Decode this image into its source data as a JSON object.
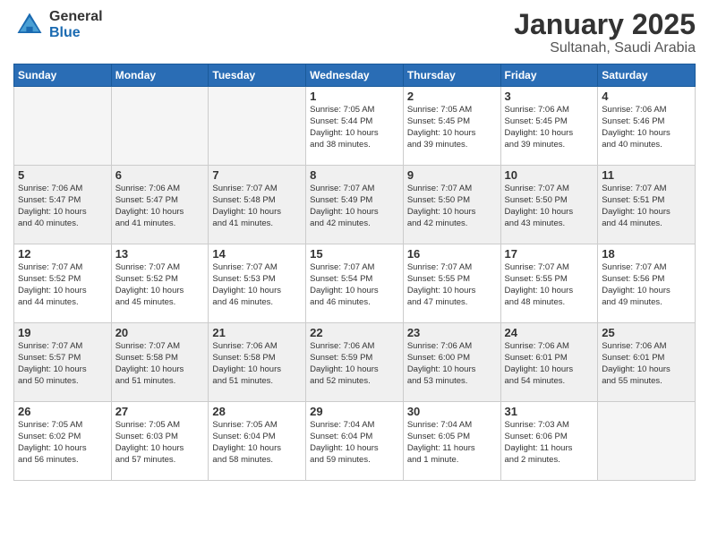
{
  "header": {
    "logo_general": "General",
    "logo_blue": "Blue",
    "month": "January 2025",
    "location": "Sultanah, Saudi Arabia"
  },
  "weekdays": [
    "Sunday",
    "Monday",
    "Tuesday",
    "Wednesday",
    "Thursday",
    "Friday",
    "Saturday"
  ],
  "weeks": [
    [
      {
        "day": "",
        "info": "",
        "empty": true
      },
      {
        "day": "",
        "info": "",
        "empty": true
      },
      {
        "day": "",
        "info": "",
        "empty": true
      },
      {
        "day": "1",
        "info": "Sunrise: 7:05 AM\nSunset: 5:44 PM\nDaylight: 10 hours\nand 38 minutes."
      },
      {
        "day": "2",
        "info": "Sunrise: 7:05 AM\nSunset: 5:45 PM\nDaylight: 10 hours\nand 39 minutes."
      },
      {
        "day": "3",
        "info": "Sunrise: 7:06 AM\nSunset: 5:45 PM\nDaylight: 10 hours\nand 39 minutes."
      },
      {
        "day": "4",
        "info": "Sunrise: 7:06 AM\nSunset: 5:46 PM\nDaylight: 10 hours\nand 40 minutes."
      }
    ],
    [
      {
        "day": "5",
        "info": "Sunrise: 7:06 AM\nSunset: 5:47 PM\nDaylight: 10 hours\nand 40 minutes."
      },
      {
        "day": "6",
        "info": "Sunrise: 7:06 AM\nSunset: 5:47 PM\nDaylight: 10 hours\nand 41 minutes."
      },
      {
        "day": "7",
        "info": "Sunrise: 7:07 AM\nSunset: 5:48 PM\nDaylight: 10 hours\nand 41 minutes."
      },
      {
        "day": "8",
        "info": "Sunrise: 7:07 AM\nSunset: 5:49 PM\nDaylight: 10 hours\nand 42 minutes."
      },
      {
        "day": "9",
        "info": "Sunrise: 7:07 AM\nSunset: 5:50 PM\nDaylight: 10 hours\nand 42 minutes."
      },
      {
        "day": "10",
        "info": "Sunrise: 7:07 AM\nSunset: 5:50 PM\nDaylight: 10 hours\nand 43 minutes."
      },
      {
        "day": "11",
        "info": "Sunrise: 7:07 AM\nSunset: 5:51 PM\nDaylight: 10 hours\nand 44 minutes."
      }
    ],
    [
      {
        "day": "12",
        "info": "Sunrise: 7:07 AM\nSunset: 5:52 PM\nDaylight: 10 hours\nand 44 minutes."
      },
      {
        "day": "13",
        "info": "Sunrise: 7:07 AM\nSunset: 5:52 PM\nDaylight: 10 hours\nand 45 minutes."
      },
      {
        "day": "14",
        "info": "Sunrise: 7:07 AM\nSunset: 5:53 PM\nDaylight: 10 hours\nand 46 minutes."
      },
      {
        "day": "15",
        "info": "Sunrise: 7:07 AM\nSunset: 5:54 PM\nDaylight: 10 hours\nand 46 minutes."
      },
      {
        "day": "16",
        "info": "Sunrise: 7:07 AM\nSunset: 5:55 PM\nDaylight: 10 hours\nand 47 minutes."
      },
      {
        "day": "17",
        "info": "Sunrise: 7:07 AM\nSunset: 5:55 PM\nDaylight: 10 hours\nand 48 minutes."
      },
      {
        "day": "18",
        "info": "Sunrise: 7:07 AM\nSunset: 5:56 PM\nDaylight: 10 hours\nand 49 minutes."
      }
    ],
    [
      {
        "day": "19",
        "info": "Sunrise: 7:07 AM\nSunset: 5:57 PM\nDaylight: 10 hours\nand 50 minutes."
      },
      {
        "day": "20",
        "info": "Sunrise: 7:07 AM\nSunset: 5:58 PM\nDaylight: 10 hours\nand 51 minutes."
      },
      {
        "day": "21",
        "info": "Sunrise: 7:06 AM\nSunset: 5:58 PM\nDaylight: 10 hours\nand 51 minutes."
      },
      {
        "day": "22",
        "info": "Sunrise: 7:06 AM\nSunset: 5:59 PM\nDaylight: 10 hours\nand 52 minutes."
      },
      {
        "day": "23",
        "info": "Sunrise: 7:06 AM\nSunset: 6:00 PM\nDaylight: 10 hours\nand 53 minutes."
      },
      {
        "day": "24",
        "info": "Sunrise: 7:06 AM\nSunset: 6:01 PM\nDaylight: 10 hours\nand 54 minutes."
      },
      {
        "day": "25",
        "info": "Sunrise: 7:06 AM\nSunset: 6:01 PM\nDaylight: 10 hours\nand 55 minutes."
      }
    ],
    [
      {
        "day": "26",
        "info": "Sunrise: 7:05 AM\nSunset: 6:02 PM\nDaylight: 10 hours\nand 56 minutes."
      },
      {
        "day": "27",
        "info": "Sunrise: 7:05 AM\nSunset: 6:03 PM\nDaylight: 10 hours\nand 57 minutes."
      },
      {
        "day": "28",
        "info": "Sunrise: 7:05 AM\nSunset: 6:04 PM\nDaylight: 10 hours\nand 58 minutes."
      },
      {
        "day": "29",
        "info": "Sunrise: 7:04 AM\nSunset: 6:04 PM\nDaylight: 10 hours\nand 59 minutes."
      },
      {
        "day": "30",
        "info": "Sunrise: 7:04 AM\nSunset: 6:05 PM\nDaylight: 11 hours\nand 1 minute."
      },
      {
        "day": "31",
        "info": "Sunrise: 7:03 AM\nSunset: 6:06 PM\nDaylight: 11 hours\nand 2 minutes."
      },
      {
        "day": "",
        "info": "",
        "empty": true
      }
    ]
  ]
}
